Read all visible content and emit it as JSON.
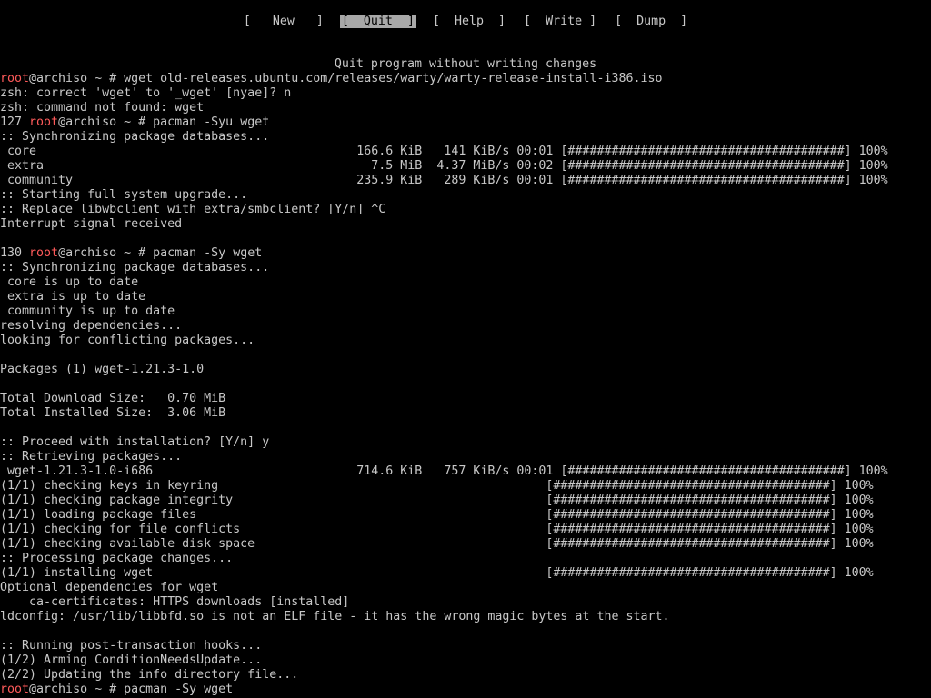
{
  "menu": {
    "items": [
      {
        "label": "[   New   ]",
        "selected": false
      },
      {
        "label": "[  Quit  ]",
        "selected": true
      },
      {
        "label": "[  Help  ]",
        "selected": false
      },
      {
        "label": "[  Write ]",
        "selected": false
      },
      {
        "label": "[  Dump  ]",
        "selected": false
      }
    ]
  },
  "status_line": "Quit program without writing changes",
  "colors": {
    "background": "#000000",
    "text": "#c8c8c8",
    "username": "#ff5a5a",
    "menu_highlight": "#a8a8a8"
  },
  "terminal": {
    "lines": [
      {
        "pre": "",
        "user": "root",
        "text": "@archiso ~ # wget old-releases.ubuntu.com/releases/warty/warty-release-install-i386.iso"
      },
      {
        "pre": "",
        "user": "",
        "text": "zsh: correct 'wget' to '_wget' [nyae]? n"
      },
      {
        "pre": "",
        "user": "",
        "text": "zsh: command not found: wget"
      },
      {
        "pre": "127 ",
        "user": "root",
        "text": "@archiso ~ # pacman -Syu wget"
      },
      {
        "pre": "",
        "user": "",
        "text": ":: Synchronizing package databases..."
      },
      {
        "pre": "",
        "user": "",
        "text": " core                                            166.6 KiB   141 KiB/s 00:01 [######################################] 100%"
      },
      {
        "pre": "",
        "user": "",
        "text": " extra                                             7.5 MiB  4.37 MiB/s 00:02 [######################################] 100%"
      },
      {
        "pre": "",
        "user": "",
        "text": " community                                       235.9 KiB   289 KiB/s 00:01 [######################################] 100%"
      },
      {
        "pre": "",
        "user": "",
        "text": ":: Starting full system upgrade..."
      },
      {
        "pre": "",
        "user": "",
        "text": ":: Replace libwbclient with extra/smbclient? [Y/n] ^C"
      },
      {
        "pre": "",
        "user": "",
        "text": "Interrupt signal received"
      },
      {
        "pre": "",
        "user": "",
        "text": ""
      },
      {
        "pre": "130 ",
        "user": "root",
        "text": "@archiso ~ # pacman -Sy wget"
      },
      {
        "pre": "",
        "user": "",
        "text": ":: Synchronizing package databases..."
      },
      {
        "pre": "",
        "user": "",
        "text": " core is up to date"
      },
      {
        "pre": "",
        "user": "",
        "text": " extra is up to date"
      },
      {
        "pre": "",
        "user": "",
        "text": " community is up to date"
      },
      {
        "pre": "",
        "user": "",
        "text": "resolving dependencies..."
      },
      {
        "pre": "",
        "user": "",
        "text": "looking for conflicting packages..."
      },
      {
        "pre": "",
        "user": "",
        "text": ""
      },
      {
        "pre": "",
        "user": "",
        "text": "Packages (1) wget-1.21.3-1.0"
      },
      {
        "pre": "",
        "user": "",
        "text": ""
      },
      {
        "pre": "",
        "user": "",
        "text": "Total Download Size:   0.70 MiB"
      },
      {
        "pre": "",
        "user": "",
        "text": "Total Installed Size:  3.06 MiB"
      },
      {
        "pre": "",
        "user": "",
        "text": ""
      },
      {
        "pre": "",
        "user": "",
        "text": ":: Proceed with installation? [Y/n] y"
      },
      {
        "pre": "",
        "user": "",
        "text": ":: Retrieving packages..."
      },
      {
        "pre": "",
        "user": "",
        "text": " wget-1.21.3-1.0-i686                            714.6 KiB   757 KiB/s 00:01 [######################################] 100%"
      },
      {
        "pre": "",
        "user": "",
        "text": "(1/1) checking keys in keyring                                             [######################################] 100%"
      },
      {
        "pre": "",
        "user": "",
        "text": "(1/1) checking package integrity                                           [######################################] 100%"
      },
      {
        "pre": "",
        "user": "",
        "text": "(1/1) loading package files                                                [######################################] 100%"
      },
      {
        "pre": "",
        "user": "",
        "text": "(1/1) checking for file conflicts                                          [######################################] 100%"
      },
      {
        "pre": "",
        "user": "",
        "text": "(1/1) checking available disk space                                        [######################################] 100%"
      },
      {
        "pre": "",
        "user": "",
        "text": ":: Processing package changes..."
      },
      {
        "pre": "",
        "user": "",
        "text": "(1/1) installing wget                                                      [######################################] 100%"
      },
      {
        "pre": "",
        "user": "",
        "text": "Optional dependencies for wget"
      },
      {
        "pre": "",
        "user": "",
        "text": "    ca-certificates: HTTPS downloads [installed]"
      },
      {
        "pre": "",
        "user": "",
        "text": "ldconfig: /usr/lib/libbfd.so is not an ELF file - it has the wrong magic bytes at the start."
      },
      {
        "pre": "",
        "user": "",
        "text": ""
      },
      {
        "pre": "",
        "user": "",
        "text": ":: Running post-transaction hooks..."
      },
      {
        "pre": "",
        "user": "",
        "text": "(1/2) Arming ConditionNeedsUpdate..."
      },
      {
        "pre": "",
        "user": "",
        "text": "(2/2) Updating the info directory file..."
      },
      {
        "pre": "",
        "user": "",
        "text": "@archiso ~ # pacman -Sy wget",
        "user2": "root"
      }
    ]
  }
}
